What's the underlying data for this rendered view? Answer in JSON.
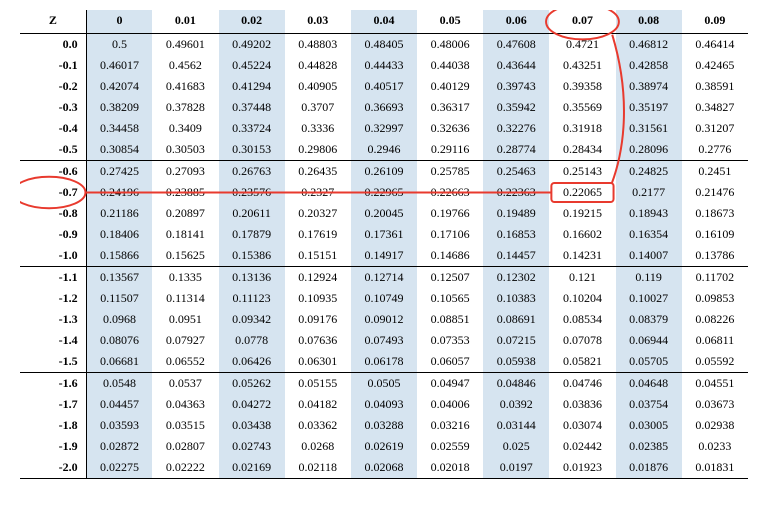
{
  "table": {
    "header_label": "Z",
    "col_headers": [
      "0",
      "0.01",
      "0.02",
      "0.03",
      "0.04",
      "0.05",
      "0.06",
      "0.07",
      "0.08",
      "0.09"
    ],
    "rows": [
      {
        "z": "0.0",
        "v": [
          "0.5",
          "0.49601",
          "0.49202",
          "0.48803",
          "0.48405",
          "0.48006",
          "0.47608",
          "0.4721",
          "0.46812",
          "0.46414"
        ]
      },
      {
        "z": "-0.1",
        "v": [
          "0.46017",
          "0.4562",
          "0.45224",
          "0.44828",
          "0.44433",
          "0.44038",
          "0.43644",
          "0.43251",
          "0.42858",
          "0.42465"
        ]
      },
      {
        "z": "-0.2",
        "v": [
          "0.42074",
          "0.41683",
          "0.41294",
          "0.40905",
          "0.40517",
          "0.40129",
          "0.39743",
          "0.39358",
          "0.38974",
          "0.38591"
        ]
      },
      {
        "z": "-0.3",
        "v": [
          "0.38209",
          "0.37828",
          "0.37448",
          "0.3707",
          "0.36693",
          "0.36317",
          "0.35942",
          "0.35569",
          "0.35197",
          "0.34827"
        ]
      },
      {
        "z": "-0.4",
        "v": [
          "0.34458",
          "0.3409",
          "0.33724",
          "0.3336",
          "0.32997",
          "0.32636",
          "0.32276",
          "0.31918",
          "0.31561",
          "0.31207"
        ]
      },
      {
        "z": "-0.5",
        "v": [
          "0.30854",
          "0.30503",
          "0.30153",
          "0.29806",
          "0.2946",
          "0.29116",
          "0.28774",
          "0.28434",
          "0.28096",
          "0.2776"
        ]
      },
      {
        "z": "-0.6",
        "v": [
          "0.27425",
          "0.27093",
          "0.26763",
          "0.26435",
          "0.26109",
          "0.25785",
          "0.25463",
          "0.25143",
          "0.24825",
          "0.2451"
        ]
      },
      {
        "z": "-0.7",
        "v": [
          "0.24196",
          "0.23885",
          "0.23576",
          "0.2327",
          "0.22965",
          "0.22663",
          "0.22363",
          "0.22065",
          "0.2177",
          "0.21476"
        ]
      },
      {
        "z": "-0.8",
        "v": [
          "0.21186",
          "0.20897",
          "0.20611",
          "0.20327",
          "0.20045",
          "0.19766",
          "0.19489",
          "0.19215",
          "0.18943",
          "0.18673"
        ]
      },
      {
        "z": "-0.9",
        "v": [
          "0.18406",
          "0.18141",
          "0.17879",
          "0.17619",
          "0.17361",
          "0.17106",
          "0.16853",
          "0.16602",
          "0.16354",
          "0.16109"
        ]
      },
      {
        "z": "-1.0",
        "v": [
          "0.15866",
          "0.15625",
          "0.15386",
          "0.15151",
          "0.14917",
          "0.14686",
          "0.14457",
          "0.14231",
          "0.14007",
          "0.13786"
        ]
      },
      {
        "z": "-1.1",
        "v": [
          "0.13567",
          "0.1335",
          "0.13136",
          "0.12924",
          "0.12714",
          "0.12507",
          "0.12302",
          "0.121",
          "0.119",
          "0.11702"
        ]
      },
      {
        "z": "-1.2",
        "v": [
          "0.11507",
          "0.11314",
          "0.11123",
          "0.10935",
          "0.10749",
          "0.10565",
          "0.10383",
          "0.10204",
          "0.10027",
          "0.09853"
        ]
      },
      {
        "z": "-1.3",
        "v": [
          "0.0968",
          "0.0951",
          "0.09342",
          "0.09176",
          "0.09012",
          "0.08851",
          "0.08691",
          "0.08534",
          "0.08379",
          "0.08226"
        ]
      },
      {
        "z": "-1.4",
        "v": [
          "0.08076",
          "0.07927",
          "0.0778",
          "0.07636",
          "0.07493",
          "0.07353",
          "0.07215",
          "0.07078",
          "0.06944",
          "0.06811"
        ]
      },
      {
        "z": "-1.5",
        "v": [
          "0.06681",
          "0.06552",
          "0.06426",
          "0.06301",
          "0.06178",
          "0.06057",
          "0.05938",
          "0.05821",
          "0.05705",
          "0.05592"
        ]
      },
      {
        "z": "-1.6",
        "v": [
          "0.0548",
          "0.0537",
          "0.05262",
          "0.05155",
          "0.0505",
          "0.04947",
          "0.04846",
          "0.04746",
          "0.04648",
          "0.04551"
        ]
      },
      {
        "z": "-1.7",
        "v": [
          "0.04457",
          "0.04363",
          "0.04272",
          "0.04182",
          "0.04093",
          "0.04006",
          "0.0392",
          "0.03836",
          "0.03754",
          "0.03673"
        ]
      },
      {
        "z": "-1.8",
        "v": [
          "0.03593",
          "0.03515",
          "0.03438",
          "0.03362",
          "0.03288",
          "0.03216",
          "0.03144",
          "0.03074",
          "0.03005",
          "0.02938"
        ]
      },
      {
        "z": "-1.9",
        "v": [
          "0.02872",
          "0.02807",
          "0.02743",
          "0.0268",
          "0.02619",
          "0.02559",
          "0.025",
          "0.02442",
          "0.02385",
          "0.0233"
        ]
      },
      {
        "z": "-2.0",
        "v": [
          "0.02275",
          "0.02222",
          "0.02169",
          "0.02118",
          "0.02068",
          "0.02018",
          "0.0197",
          "0.01923",
          "0.01876",
          "0.01831"
        ]
      }
    ],
    "group_breaks_after": [
      "-0.5",
      "-1.0",
      "-1.5",
      "-2.0"
    ]
  },
  "annotation": {
    "circle_col_header": "0.07",
    "circle_row_header": "-0.7",
    "target_cell": "0.22065",
    "color": "#e83a2e"
  }
}
